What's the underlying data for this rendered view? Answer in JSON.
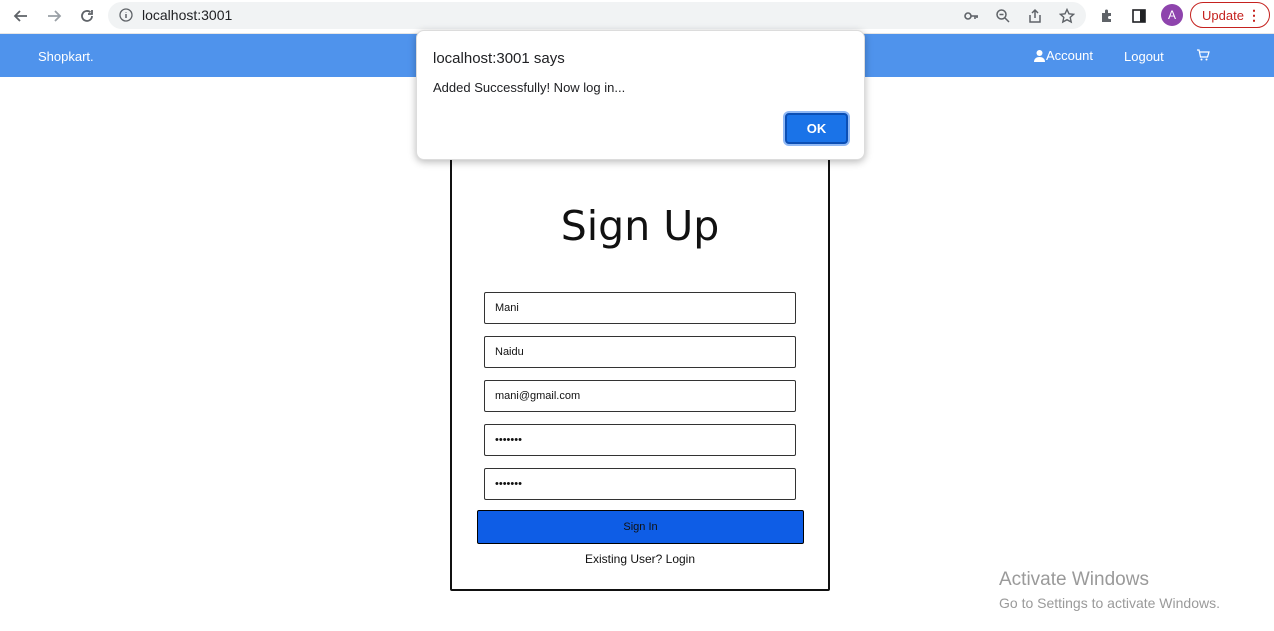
{
  "browser": {
    "url": "localhost:3001",
    "avatar_letter": "A",
    "update_label": "Update",
    "menu_glyph": "⋮"
  },
  "navbar": {
    "brand": "Shopkart.",
    "account_label": "Account",
    "logout_label": "Logout",
    "color": "#4f93ec"
  },
  "signup": {
    "title": "Sign Up",
    "fields": {
      "first_name": "Mani",
      "last_name": "Naidu",
      "email": "mani@gmail.com",
      "password": "•••••••",
      "confirm_password": "•••••••"
    },
    "submit_label": "Sign In",
    "existing_user_text": "Existing User? Login",
    "button_color": "#0e5de6"
  },
  "dialog": {
    "title": "localhost:3001 says",
    "message": "Added Successfully! Now log in...",
    "ok_label": "OK"
  },
  "watermark": {
    "title": "Activate Windows",
    "subtitle": "Go to Settings to activate Windows."
  }
}
